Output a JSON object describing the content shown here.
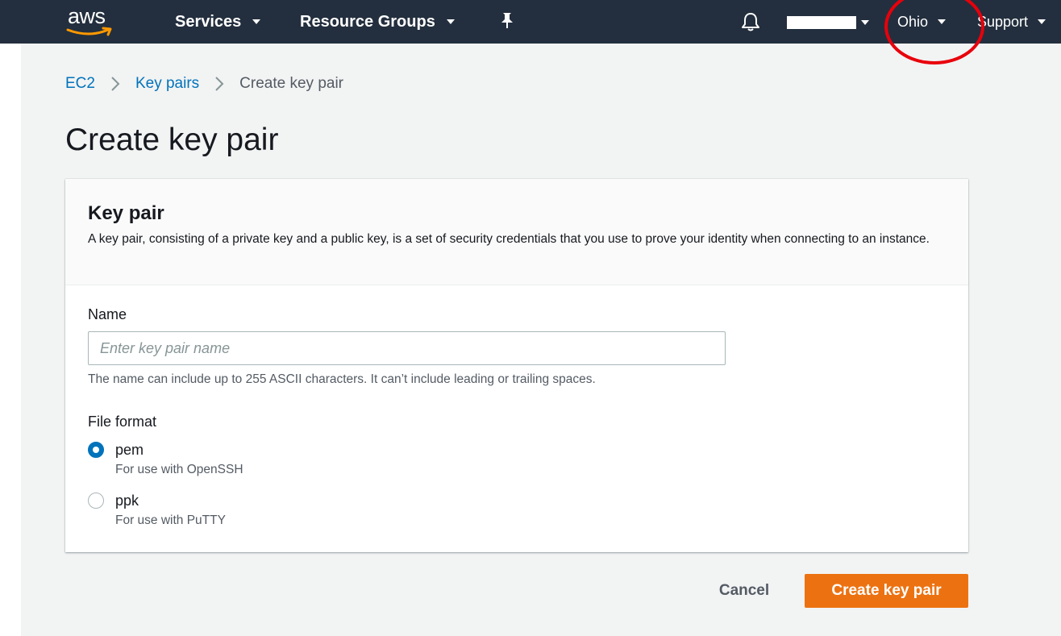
{
  "colors": {
    "nav_background": "#232f3e",
    "link": "#0073bb",
    "primary_button": "#ec7211",
    "content_background": "#f2f3f3",
    "annotation": "#e8000b"
  },
  "topnav": {
    "logo_text": "aws",
    "logo_icon": "aws-smile-icon",
    "services_label": "Services",
    "resource_groups_label": "Resource Groups",
    "pin_icon": "pin-icon",
    "bell_icon": "bell-icon",
    "region_label": "Ohio",
    "support_label": "Support"
  },
  "breadcrumb": {
    "items": [
      {
        "label": "EC2"
      },
      {
        "label": "Key pairs"
      },
      {
        "label": "Create key pair"
      }
    ]
  },
  "page": {
    "title": "Create key pair"
  },
  "card": {
    "title": "Key pair",
    "description": "A key pair, consisting of a private key and a public key, is a set of security credentials that you use to prove your identity when connecting to an instance.",
    "name_label": "Name",
    "name_value": "",
    "name_placeholder": "Enter key pair name",
    "name_constraint": "The name can include up to 255 ASCII characters. It can’t include leading or trailing spaces.",
    "file_format_label": "File format",
    "options": [
      {
        "label": "pem",
        "description": "For use with OpenSSH",
        "selected": true
      },
      {
        "label": "ppk",
        "description": "For use with PuTTY",
        "selected": false
      }
    ]
  },
  "actions": {
    "cancel_label": "Cancel",
    "create_label": "Create key pair"
  }
}
